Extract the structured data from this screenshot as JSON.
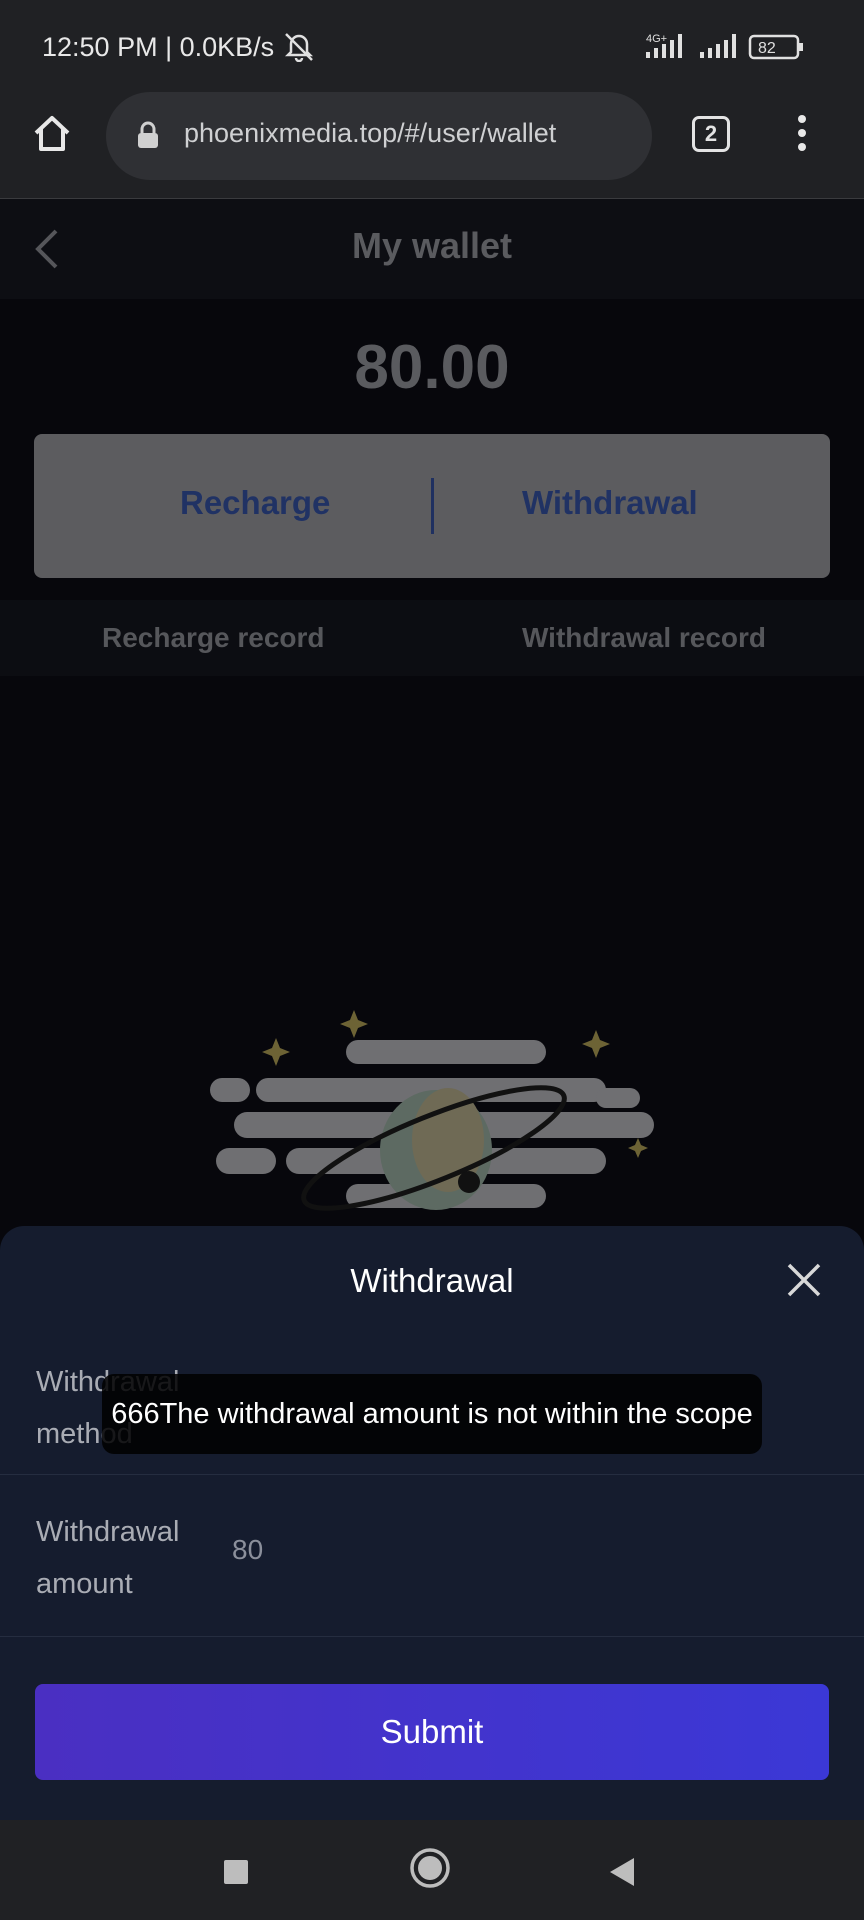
{
  "status_bar": {
    "time": "12:50 PM | 0.0KB/s",
    "network_type": "4G+",
    "battery": "82"
  },
  "browser": {
    "url": "phoenixmedia.top/#/user/wallet",
    "tab_count": "2"
  },
  "page": {
    "title": "My wallet",
    "balance": "80.00",
    "actions": {
      "recharge": "Recharge",
      "withdrawal": "Withdrawal"
    },
    "record_tabs": [
      "Recharge record",
      "Withdrawal record"
    ]
  },
  "sheet": {
    "title": "Withdrawal",
    "method_label": "Withdrawal method",
    "amount_label": "Withdrawal amount",
    "amount_value": "80",
    "submit_label": "Submit"
  },
  "toast": {
    "message": "666The withdrawal amount is not within the scope"
  },
  "icons": {
    "home": "home-icon",
    "lock": "lock-icon",
    "menu": "more-vert-icon",
    "back": "chevron-left-icon",
    "close": "close-icon"
  }
}
